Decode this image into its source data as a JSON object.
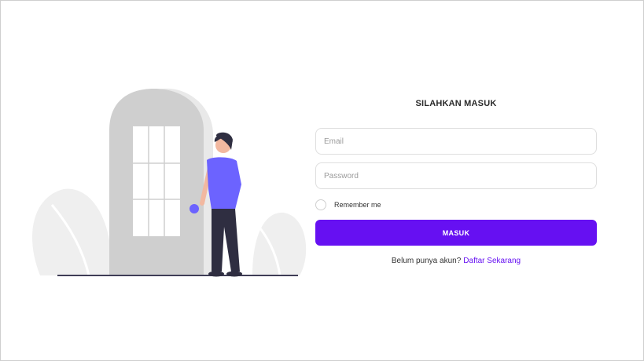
{
  "login": {
    "title": "SILAHKAN MASUK",
    "email": {
      "placeholder": "Email",
      "value": ""
    },
    "password": {
      "placeholder": "Password",
      "value": ""
    },
    "remember_label": "Remember me",
    "remember_checked": false,
    "submit_label": "MASUK",
    "register_prompt": "Belum punya akun?",
    "register_link": "Daftar Sekarang"
  },
  "colors": {
    "primary": "#6610f2",
    "figure_shirt": "#6c63ff",
    "door": "#cfcfcf",
    "leaves": "#efefef"
  },
  "illustration": {
    "icon": "person-at-door-illustration"
  }
}
